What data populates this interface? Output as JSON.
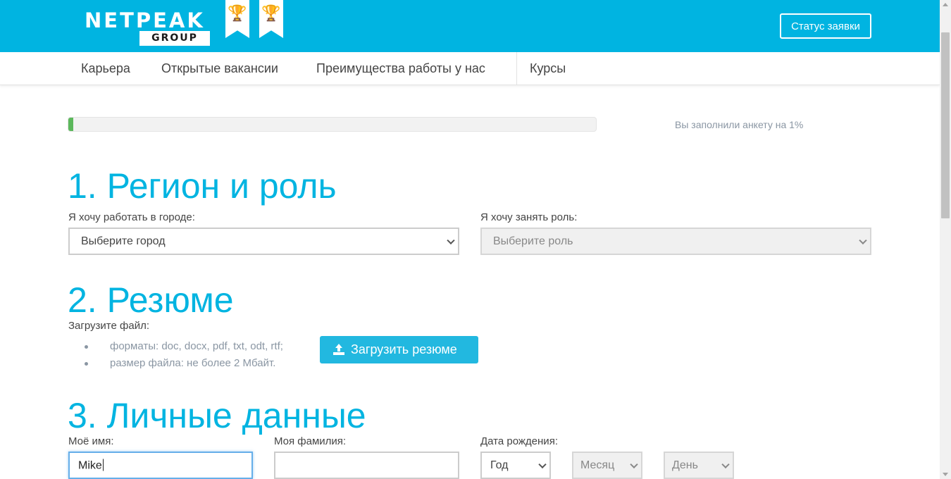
{
  "header": {
    "logo_top": "NETPEAK",
    "logo_bottom": "GROUP",
    "status_button": "Статус заявки",
    "brand_color": "#00b4e1"
  },
  "nav": {
    "items": [
      "Карьера",
      "Открытые вакансии",
      "Преимущества работы у нас",
      "Курсы"
    ]
  },
  "progress": {
    "percent": 1,
    "text": "Вы заполнили анкету на 1%",
    "fill_color": "#5cb85c"
  },
  "section1": {
    "title": "1. Регион и роль",
    "city_label": "Я хочу работать в городе:",
    "city_value": "Выберите город",
    "role_label": "Я хочу занять роль:",
    "role_value": "Выберите роль"
  },
  "section2": {
    "title": "2. Резюме",
    "upload_label": "Загрузите файл:",
    "bullets": [
      "форматы: doc, docx, pdf, txt, odt, rtf;",
      "размер файла: не более 2 Мбайт."
    ],
    "upload_button": "Загрузить резюме"
  },
  "section3": {
    "title": "3. Личные данные",
    "first_name_label": "Моё имя:",
    "first_name_value": "Mike",
    "last_name_label": "Моя фамилия:",
    "last_name_value": "",
    "birth_label": "Дата рождения:",
    "year_value": "Год",
    "month_value": "Месяц",
    "day_value": "День"
  },
  "icons": {
    "trophy": "trophy-icon",
    "upload": "upload-icon",
    "chevron": "chevron-down-icon"
  }
}
